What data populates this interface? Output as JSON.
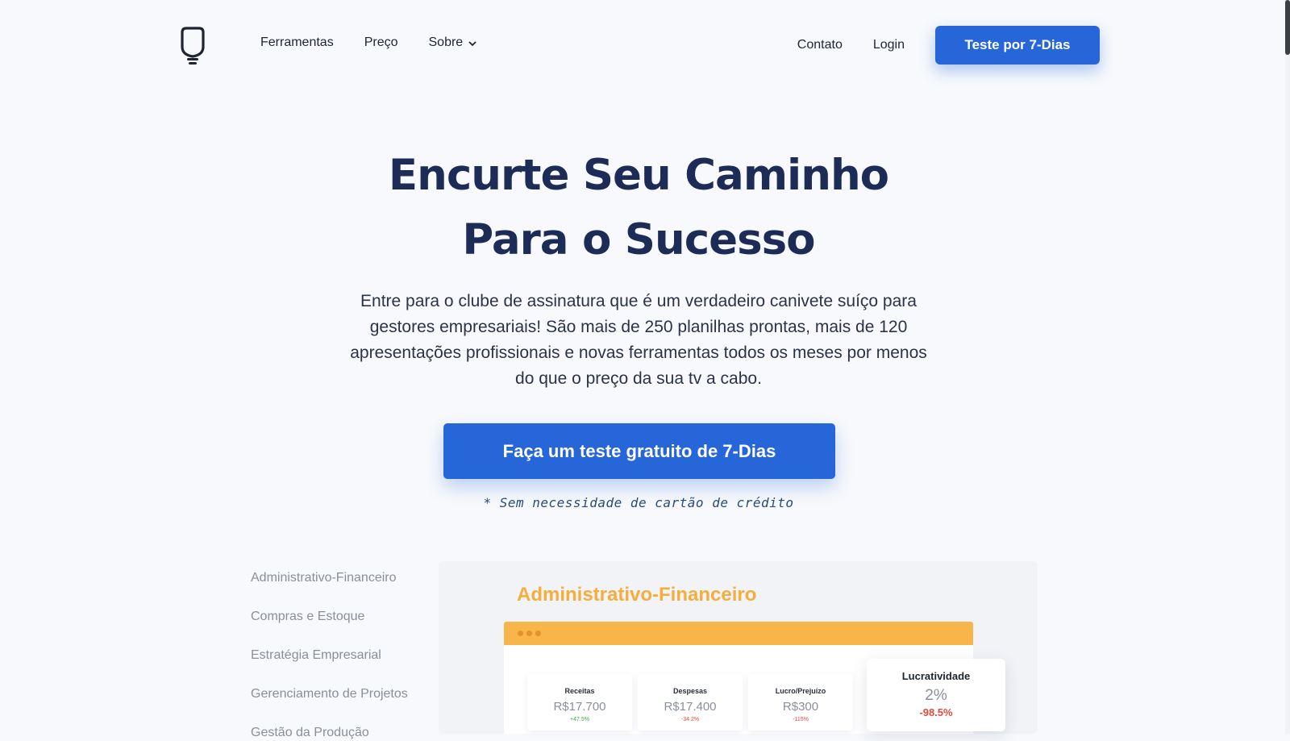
{
  "colors": {
    "accent": "#2666d9",
    "title": "#1d2b57",
    "preview_title": "#f5ae3c",
    "window_bar": "#f7b54a",
    "positive": "#3aa34a",
    "negative": "#e04a3a"
  },
  "header": {
    "logo_icon": "lightbulb-outline-icon",
    "nav_left": [
      {
        "label": "Ferramentas"
      },
      {
        "label": "Preço"
      },
      {
        "label": "Sobre",
        "icon": "chevron-down-icon"
      }
    ],
    "nav_right": [
      {
        "label": "Contato"
      },
      {
        "label": "Login"
      }
    ],
    "cta_label": "Teste por 7-Dias"
  },
  "hero": {
    "title_line1": "Encurte Seu Caminho",
    "title_line2": "Para o Sucesso",
    "subtitle": "Entre para o clube de assinatura que é um verdadeiro canivete suíço para gestores empresariais! São mais de 250 planilhas prontas, mais de 120 apresentações profissionais e novas ferramentas todos os meses por menos do que o preço da sua tv a cabo.",
    "cta_label": "Faça um teste gratuito de 7-Dias",
    "note": "* Sem necessidade de cartão de crédito"
  },
  "categories": [
    "Administrativo-Financeiro",
    "Compras e Estoque",
    "Estratégia Empresarial",
    "Gerenciamento de Projetos",
    "Gestão da Produção"
  ],
  "preview": {
    "title": "Administrativo-Financeiro",
    "kpis": [
      {
        "label": "Receitas",
        "value": "R$17.700",
        "delta": "+47.5%"
      },
      {
        "label": "Despesas",
        "value": "R$17.400",
        "delta": "-34.2%"
      },
      {
        "label": "Lucro/Prejuízo",
        "value": "R$300",
        "delta": "-115%"
      }
    ],
    "highlight": {
      "label": "Lucratividade",
      "value": "2%",
      "delta": "-98.5%"
    }
  }
}
